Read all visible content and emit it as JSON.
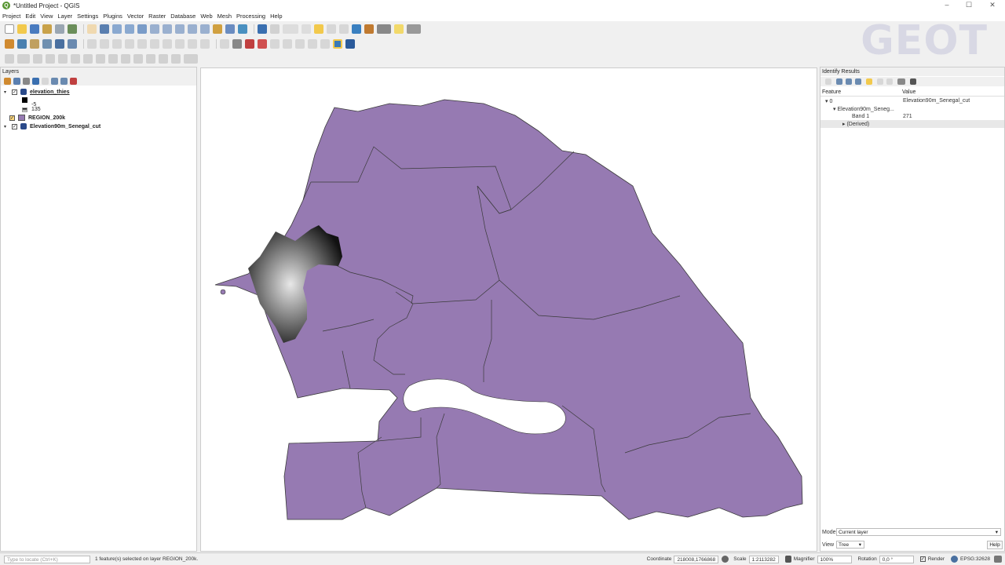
{
  "window": {
    "title": "*Untitled Project - QGIS",
    "logo_letter": "Q"
  },
  "window_controls": {
    "minimize": "–",
    "maximize": "☐",
    "close": "✕"
  },
  "menu": [
    "Project",
    "Edit",
    "View",
    "Layer",
    "Settings",
    "Plugins",
    "Vector",
    "Raster",
    "Database",
    "Web",
    "Mesh",
    "Processing",
    "Help"
  ],
  "watermark": {
    "text": "GEOT"
  },
  "layers_panel": {
    "title": "Layers",
    "items": [
      {
        "name": "elevation_thies",
        "checked": "✓",
        "expanded": "▾"
      },
      {
        "legend_min": "-5"
      },
      {
        "legend_max": "135"
      },
      {
        "name": "REGION_200k",
        "checked": "✓",
        "color": "#967ab2"
      },
      {
        "name": "Elevation90m_Senegal_cut",
        "checked": "✓",
        "expanded": "▾"
      }
    ]
  },
  "identify_panel": {
    "title": "Identify Results",
    "col_feature": "Feature",
    "col_value": "Value",
    "rows": [
      {
        "feature": "0",
        "value": "Elevation90m_Senegal_cut"
      },
      {
        "feature": "Elevation90m_Seneg...",
        "value": ""
      },
      {
        "feature": "Band 1",
        "value": "271"
      },
      {
        "feature": "(Derived)",
        "value": ""
      }
    ],
    "mode_label": "Mode",
    "mode_value": "Current layer",
    "view_label": "View",
    "view_value": "Tree",
    "help_label": "Help"
  },
  "status": {
    "search_placeholder": "Type to locate (Ctrl+K)",
    "message": "1 feature(s) selected on layer REGION_200k.",
    "coordinate_label": "Coordinate",
    "coordinate_value": "218008,1766868",
    "scale_label": "Scale",
    "scale_value": "1:2113282",
    "magnifier_label": "Magnifier",
    "magnifier_value": "100%",
    "rotation_label": "Rotation",
    "rotation_value": "0,0 °",
    "render_label": "Render",
    "crs": "EPSG:32628"
  },
  "colors": {
    "region_fill": "#967ab2",
    "region_stroke": "#3a3a3a",
    "qgis_green": "#589632"
  }
}
